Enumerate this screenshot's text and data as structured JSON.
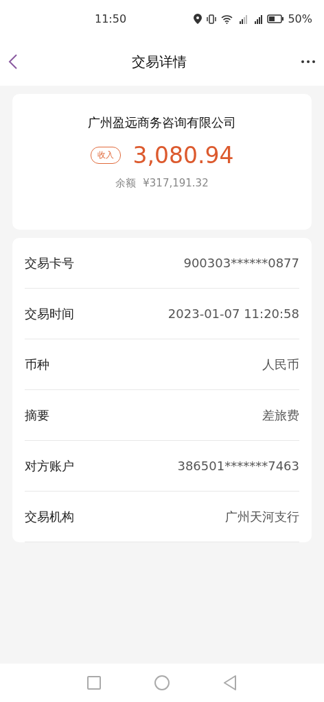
{
  "status_bar": {
    "time": "11:50",
    "battery_text": "50%"
  },
  "header": {
    "title": "交易详情"
  },
  "summary": {
    "counterparty": "广州盈远商务咨询有限公司",
    "tag": "收入",
    "amount": "3,080.94",
    "balance_label": "余额",
    "balance": "¥317,191.32"
  },
  "details": [
    {
      "label": "交易卡号",
      "value": "900303******0877"
    },
    {
      "label": "交易时间",
      "value": "2023-01-07 11:20:58"
    },
    {
      "label": "币种",
      "value": "人民币"
    },
    {
      "label": "摘要",
      "value": "差旅费"
    },
    {
      "label": "对方账户",
      "value": "386501*******7463"
    },
    {
      "label": "交易机构",
      "value": "广州天河支行"
    }
  ]
}
